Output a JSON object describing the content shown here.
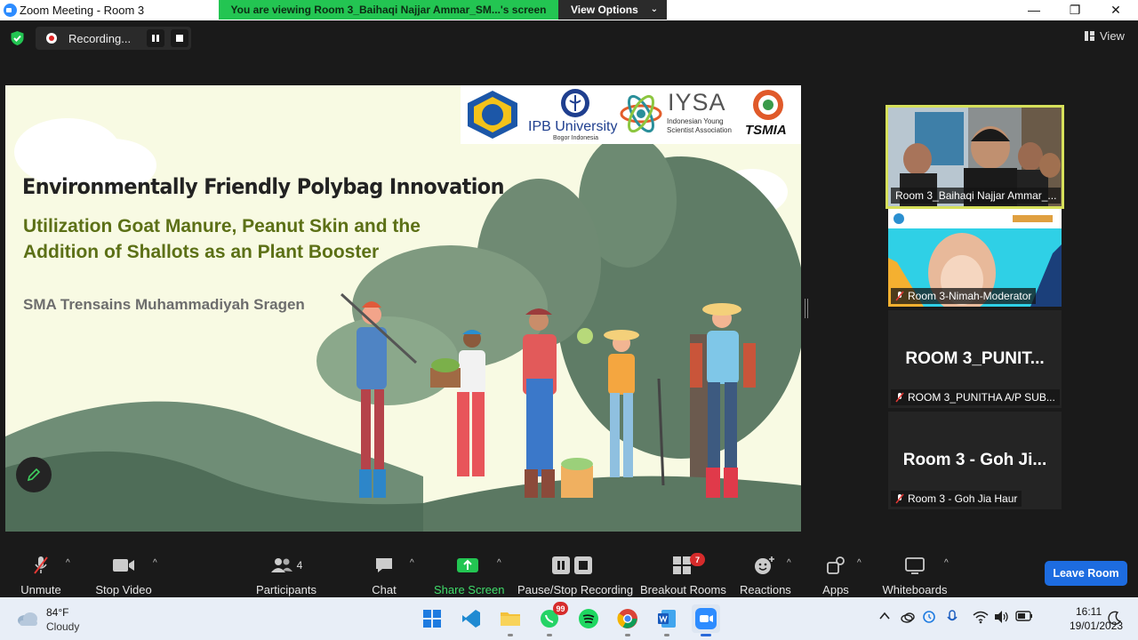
{
  "window": {
    "title": "Zoom Meeting - Room 3",
    "controls": {
      "minimize": "—",
      "maximize": "❐",
      "close": "✕"
    }
  },
  "banner": {
    "viewing_text": "You are viewing Room 3_Baihaqi Najjar Ammar_SM...'s screen",
    "view_options": "View Options",
    "banner_color": "#23c552"
  },
  "topbar": {
    "recording_label": "Recording...",
    "view_label": "View"
  },
  "slide": {
    "title": "Environmentally Friendly Polybag Innovation",
    "subtitle_line1": "Utilization Goat Manure, Peanut Skin and the",
    "subtitle_line2": "Addition of Shallots as an Plant Booster",
    "school": "SMA Trensains Muhammadiyah Sragen",
    "logos": {
      "ipb_name": "IPB University",
      "ipb_sub": "Bogor Indonesia",
      "iysa_name": "IYSA",
      "iysa_line1": "Indonesian Young",
      "iysa_line2": "Scientist Association",
      "tsmu": "TSMIA"
    },
    "accent_color": "#5c7016"
  },
  "participants": [
    {
      "name": "Room 3_Baihaqi Najjar Ammar_...",
      "active": true
    },
    {
      "name": "Room 3-Nimah-Moderator",
      "muted": true
    },
    {
      "big_name": "ROOM  3_PUNIT...",
      "name": "ROOM 3_PUNITHA A/P SUB...",
      "muted": true
    },
    {
      "big_name": "Room 3 - Goh Ji...",
      "name": "Room 3 - Goh Jia Haur",
      "muted": true
    }
  ],
  "toolbar": {
    "unmute": "Unmute",
    "stop_video": "Stop Video",
    "participants": "Participants",
    "participants_count": "4",
    "chat": "Chat",
    "share_screen": "Share Screen",
    "pause_stop_recording": "Pause/Stop Recording",
    "breakout_rooms": "Breakout Rooms",
    "breakout_badge": "7",
    "reactions": "Reactions",
    "apps": "Apps",
    "whiteboards": "Whiteboards",
    "leave": "Leave Room"
  },
  "taskbar": {
    "weather_temp": "84°F",
    "weather_desc": "Cloudy",
    "whatsapp_badge": "99",
    "time": "16:11",
    "date": "19/01/2023"
  }
}
